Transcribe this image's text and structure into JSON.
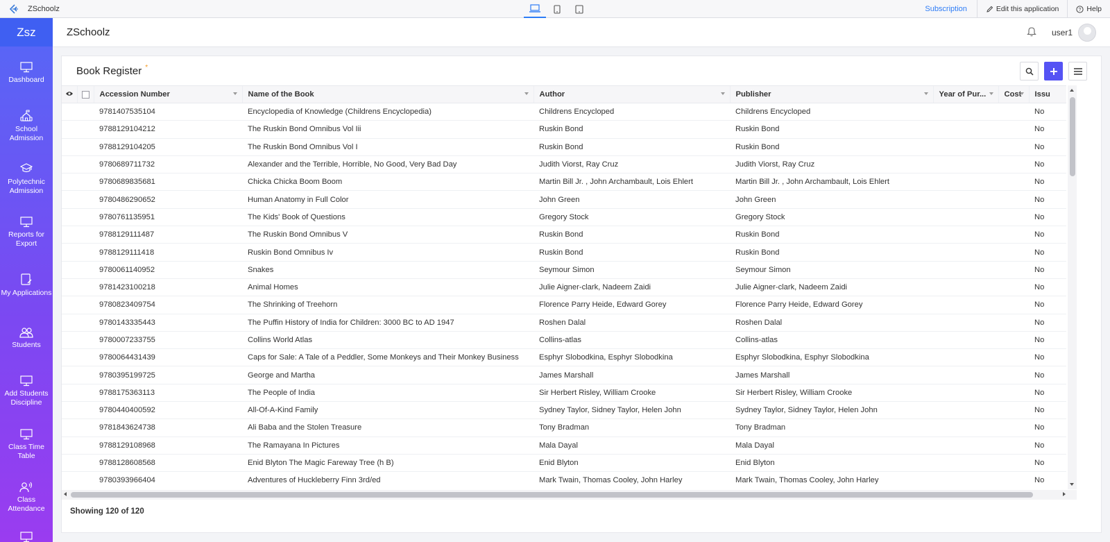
{
  "topbar": {
    "app_name": "ZSchoolz",
    "subscription_label": "Subscription",
    "edit_label": "Edit this application",
    "help_label": "Help"
  },
  "sidebar": {
    "brand": "Zsz",
    "items": [
      {
        "label": "Dashboard",
        "icon": "monitor-icon"
      },
      {
        "label": "School Admission",
        "icon": "school-icon"
      },
      {
        "label": "Polytechnic Admission",
        "icon": "graduation-cap-icon"
      },
      {
        "label": "Reports for Export",
        "icon": "monitor-icon"
      },
      {
        "label": "My Applications",
        "icon": "tablet-edit-icon"
      },
      {
        "label": "Students",
        "icon": "users-icon"
      },
      {
        "label": "Add Students Discipline",
        "icon": "monitor-icon"
      },
      {
        "label": "Class Time Table",
        "icon": "monitor-icon"
      },
      {
        "label": "Class Attendance",
        "icon": "user-voice-icon"
      },
      {
        "label": "",
        "icon": "monitor-icon"
      }
    ]
  },
  "header": {
    "title": "ZSchoolz",
    "user": "user1"
  },
  "report": {
    "title": "Book Register",
    "columns": [
      "Accession Number",
      "Name of the Book",
      "Author",
      "Publisher",
      "Year of Pur...",
      "Cost",
      "Issu"
    ],
    "rows": [
      [
        "9781407535104",
        "Encyclopedia of Knowledge (Childrens Encyclopedia)",
        "Childrens Encycloped",
        "Childrens Encycloped",
        "",
        "",
        "No"
      ],
      [
        "9788129104212",
        "The Ruskin Bond Omnibus Vol Iii",
        "Ruskin Bond",
        "Ruskin Bond",
        "",
        "",
        "No"
      ],
      [
        "9788129104205",
        "The Ruskin Bond Omnibus Vol I",
        "Ruskin Bond",
        "Ruskin Bond",
        "",
        "",
        "No"
      ],
      [
        "9780689711732",
        "Alexander and the Terrible, Horrible, No Good, Very Bad Day",
        "Judith Viorst, Ray Cruz",
        "Judith Viorst, Ray Cruz",
        "",
        "",
        "No"
      ],
      [
        "9780689835681",
        "Chicka Chicka Boom Boom",
        "Martin Bill Jr. , John Archambault, Lois Ehlert",
        "Martin Bill Jr. , John Archambault, Lois Ehlert",
        "",
        "",
        "No"
      ],
      [
        "9780486290652",
        "Human Anatomy in Full Color",
        "John Green",
        "John Green",
        "",
        "",
        "No"
      ],
      [
        "9780761135951",
        "The Kids' Book of Questions",
        "Gregory Stock",
        "Gregory Stock",
        "",
        "",
        "No"
      ],
      [
        "9788129111487",
        "The Ruskin Bond Omnibus V",
        "Ruskin Bond",
        "Ruskin Bond",
        "",
        "",
        "No"
      ],
      [
        "9788129111418",
        "Ruskin Bond Omnibus Iv",
        "Ruskin Bond",
        "Ruskin Bond",
        "",
        "",
        "No"
      ],
      [
        "9780061140952",
        "Snakes",
        "Seymour Simon",
        "Seymour Simon",
        "",
        "",
        "No"
      ],
      [
        "9781423100218",
        "Animal Homes",
        "Julie Aigner-clark, Nadeem Zaidi",
        "Julie Aigner-clark, Nadeem Zaidi",
        "",
        "",
        "No"
      ],
      [
        "9780823409754",
        "The Shrinking of Treehorn",
        "Florence Parry Heide, Edward Gorey",
        "Florence Parry Heide, Edward Gorey",
        "",
        "",
        "No"
      ],
      [
        "9780143335443",
        "The Puffin History of India for Children: 3000 BC to AD 1947",
        "Roshen Dalal",
        "Roshen Dalal",
        "",
        "",
        "No"
      ],
      [
        "9780007233755",
        "Collins World Atlas",
        "Collins-atlas",
        "Collins-atlas",
        "",
        "",
        "No"
      ],
      [
        "9780064431439",
        "Caps for Sale: A Tale of a Peddler, Some Monkeys and Their Monkey Business",
        "Esphyr Slobodkina, Esphyr Slobodkina",
        "Esphyr Slobodkina, Esphyr Slobodkina",
        "",
        "",
        "No"
      ],
      [
        "9780395199725",
        "George and Martha",
        "James Marshall",
        "James Marshall",
        "",
        "",
        "No"
      ],
      [
        "9788175363113",
        "The People of India",
        "Sir Herbert Risley, William Crooke",
        "Sir Herbert Risley, William Crooke",
        "",
        "",
        "No"
      ],
      [
        "9780440400592",
        "All-Of-A-Kind Family",
        "Sydney Taylor, Sidney Taylor, Helen John",
        "Sydney Taylor, Sidney Taylor, Helen John",
        "",
        "",
        "No"
      ],
      [
        "9781843624738",
        "Ali Baba and the Stolen Treasure",
        "Tony Bradman",
        "Tony Bradman",
        "",
        "",
        "No"
      ],
      [
        "9788129108968",
        "The Ramayana In Pictures",
        "Mala Dayal",
        "Mala Dayal",
        "",
        "",
        "No"
      ],
      [
        "9788128608568",
        "Enid Blyton The Magic Fareway Tree (h B)",
        "Enid Blyton",
        "Enid Blyton",
        "",
        "",
        "No"
      ],
      [
        "9780393966404",
        "Adventures of Huckleberry Finn 3rd/ed",
        "Mark Twain, Thomas Cooley, John Harley",
        "Mark Twain, Thomas Cooley, John Harley",
        "",
        "",
        "No"
      ]
    ],
    "footer": "Showing 120 of 120"
  },
  "colors": {
    "accent": "#5553f4",
    "link": "#2e7cf6",
    "sidebar_top": "#5568f6",
    "sidebar_bottom": "#9a3cf0",
    "required_star": "#f59a23"
  }
}
